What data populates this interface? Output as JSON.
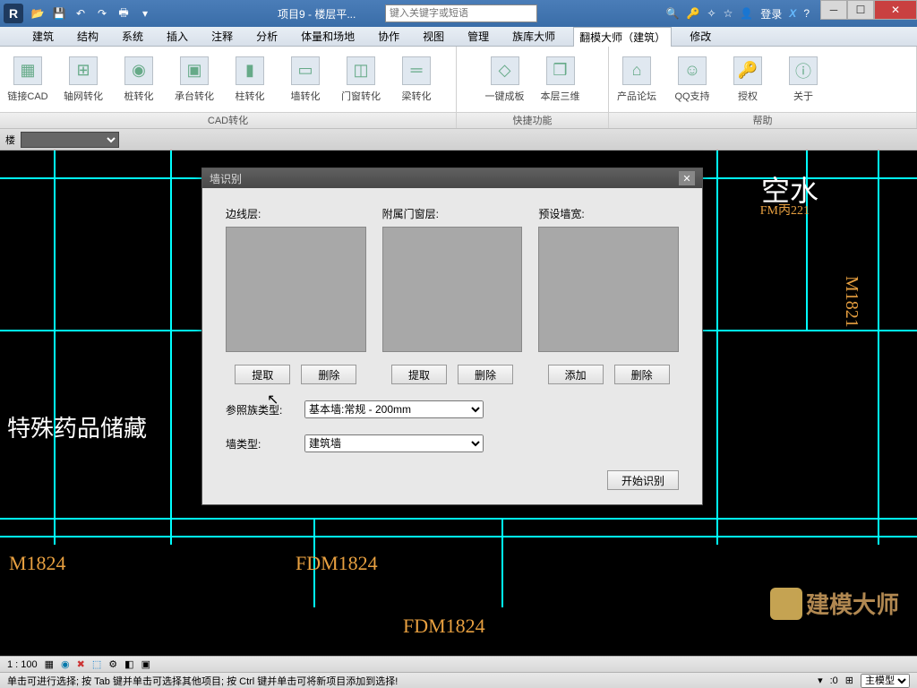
{
  "titlebar": {
    "app_letter": "R",
    "title": "项目9 - 楼层平...",
    "search_placeholder": "键入关键字或短语",
    "login": "登录"
  },
  "menu": {
    "items": [
      "建筑",
      "结构",
      "系统",
      "插入",
      "注释",
      "分析",
      "体量和场地",
      "协作",
      "视图",
      "管理",
      "族库大师",
      "翻模大师（建筑）",
      "修改"
    ],
    "active_index": 11
  },
  "ribbon": {
    "groups": [
      {
        "label": "CAD转化",
        "buttons": [
          "链接CAD",
          "轴网转化",
          "桩转化",
          "承台转化",
          "柱转化",
          "墙转化",
          "门窗转化",
          "梁转化"
        ]
      },
      {
        "label": "快捷功能",
        "buttons": [
          "一键成板",
          "本层三维"
        ]
      },
      {
        "label": "帮助",
        "buttons": [
          "产品论坛",
          "QQ支持",
          "授权",
          "关于"
        ]
      }
    ]
  },
  "subbar": {
    "label": "楼"
  },
  "dialog": {
    "title": "墙识别",
    "cols": [
      {
        "label": "边线层:",
        "btn1": "提取",
        "btn2": "删除"
      },
      {
        "label": "附属门窗层:",
        "btn1": "提取",
        "btn2": "删除"
      },
      {
        "label": "预设墙宽:",
        "btn1": "添加",
        "btn2": "删除"
      }
    ],
    "family_label": "参照族类型:",
    "family_value": "基本墙:常规 - 200mm",
    "walltype_label": "墙类型:",
    "walltype_value": "建筑墙",
    "start": "开始识别"
  },
  "canvas_text": {
    "room1": "特殊药品储藏",
    "m1824": "M1824",
    "fdm1824a": "FDM1824",
    "fdm1824b": "FDM1824",
    "kongshui": "空水",
    "fm221": "FM丙221",
    "m1821": "M1821"
  },
  "statusbar": {
    "zoom": "1 : 100",
    "hint": "单击可进行选择; 按 Tab 键并单击可选择其他项目; 按 Ctrl 键并单击可将新项目添加到选择!",
    "zero": ":0",
    "model": "主模型"
  },
  "watermark": "建模大师"
}
